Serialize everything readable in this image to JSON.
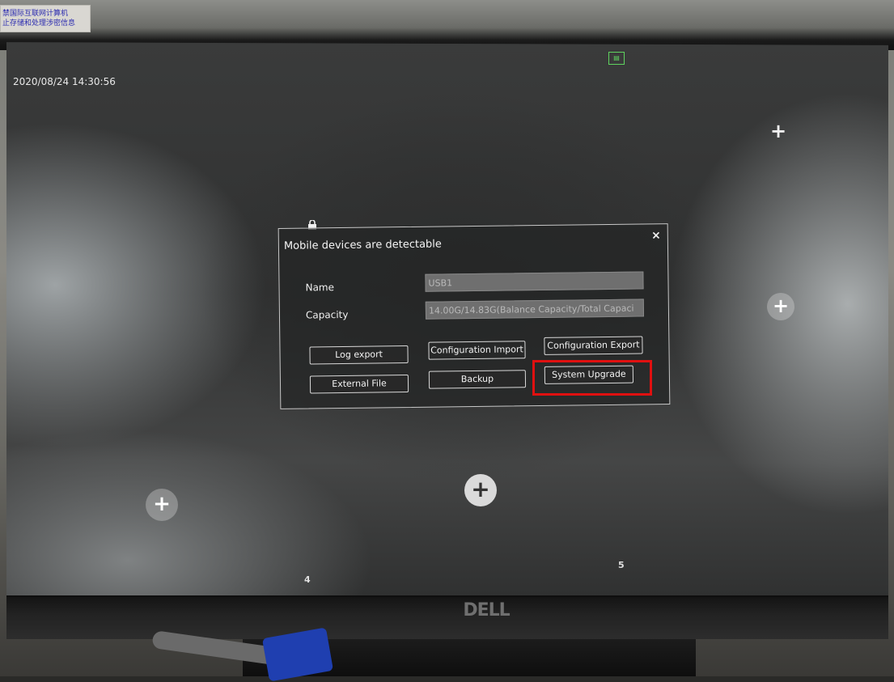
{
  "sticker": {
    "text": "禁国际互联网计算机\n止存储和处理涉密信息"
  },
  "overlay": {
    "timestamp": "2020/08/24 14:30:56",
    "channel_numbers": [
      "4",
      "5"
    ]
  },
  "dialog": {
    "title": "Mobile devices are detectable",
    "close_label": "×",
    "fields": [
      {
        "label": "Name",
        "value": "USB1"
      },
      {
        "label": "Capacity",
        "value": "14.00G/14.83G(Balance Capacity/Total Capaci"
      }
    ],
    "buttons": {
      "log_export": "Log export",
      "configuration_import": "Configuration Import",
      "configuration_export": "Configuration Export",
      "external_file": "External File",
      "backup": "Backup",
      "system_upgrade": "System Upgrade"
    }
  },
  "monitor": {
    "brand": "DELL"
  },
  "colors": {
    "highlight": "#e01010",
    "hdd_indicator": "#5fd35f"
  },
  "icons": [
    "lock-icon",
    "hdd-status-icon",
    "add-channel-icon",
    "close-icon"
  ]
}
